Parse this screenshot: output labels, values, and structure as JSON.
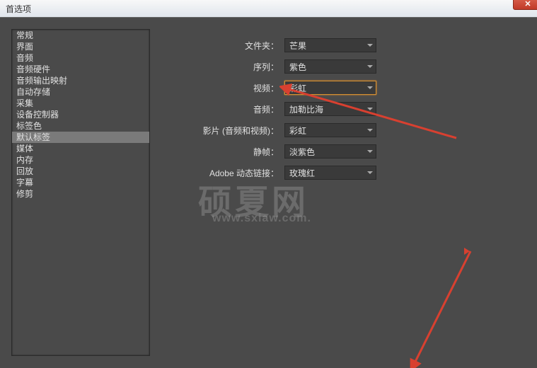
{
  "titlebar": {
    "title": "首选项"
  },
  "sidebar": {
    "items": [
      {
        "label": "常规"
      },
      {
        "label": "界面"
      },
      {
        "label": "音频"
      },
      {
        "label": "音频硬件"
      },
      {
        "label": "音频输出映射"
      },
      {
        "label": "自动存储"
      },
      {
        "label": "采集"
      },
      {
        "label": "设备控制器"
      },
      {
        "label": "标签色"
      },
      {
        "label": "默认标签",
        "selected": true
      },
      {
        "label": "媒体"
      },
      {
        "label": "内存"
      },
      {
        "label": "回放"
      },
      {
        "label": "字幕"
      },
      {
        "label": "修剪"
      }
    ]
  },
  "form": {
    "rows": [
      {
        "label": "文件夹：",
        "value": "芒果"
      },
      {
        "label": "序列：",
        "value": "紫色"
      },
      {
        "label": "视频：",
        "value": "彩虹",
        "highlighted": true
      },
      {
        "label": "音频：",
        "value": "加勒比海"
      },
      {
        "label": "影片 (音频和视频)：",
        "value": "彩虹"
      },
      {
        "label": "静帧：",
        "value": "淡紫色"
      },
      {
        "label": "Adobe 动态链接：",
        "value": "玫瑰红"
      }
    ]
  },
  "watermark": {
    "text": "硕夏网",
    "url": "www.sxiaw.com."
  }
}
